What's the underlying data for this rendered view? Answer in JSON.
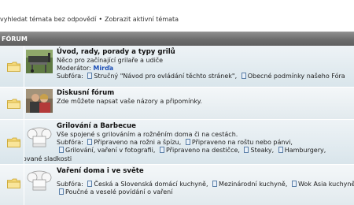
{
  "top_links": {
    "unanswered": "vyhledat témata bez odpovědí",
    "separator": "•",
    "active": "Zobrazit aktivní témata"
  },
  "header": {
    "label": "FÓRUM"
  },
  "forums": [
    {
      "title": "Úvod, rady, porady a typy grilů",
      "description": "Něco pro začínající grilaře a udiče",
      "moderator_label": "Moderátor:",
      "moderator_name": "Mirďa",
      "subforums_label": "Subfóra:",
      "subforums": [
        "Stručný \"Návod pro ovládání těchto stránek\",",
        "Obecné podmínky našeho Fóra"
      ]
    },
    {
      "title": "Diskusní fórum",
      "description": "Zde můžete napsat vaše názory a připomínky."
    },
    {
      "title": "Grilování a Barbecue",
      "description": "Vše spojené s grilováním a rožněním doma či na cestách.",
      "subforums_label": "Subfóra:",
      "subforums_line1": [
        "Připraveno na rožni a špízu,",
        "Připraveno na roštu nebo pánvi,"
      ],
      "subforums_line2": [
        "Grilování, vaření v fotografii,",
        "Připraveno na destičce,",
        "Steaky,",
        "Hamburgery,"
      ],
      "subforums_line3": [
        "Grilované sladkosti"
      ]
    },
    {
      "title": "Vaření doma i ve světe",
      "subforums_label": "Subfóra:",
      "subforums_line1": [
        "Česká a Slovenská domácí kuchyně,",
        "Mezinárodní kuchyně,",
        "Wok Asia kuchyně"
      ],
      "subforums_line2": [
        "Poučné a veselé povídání o vaření"
      ]
    }
  ]
}
